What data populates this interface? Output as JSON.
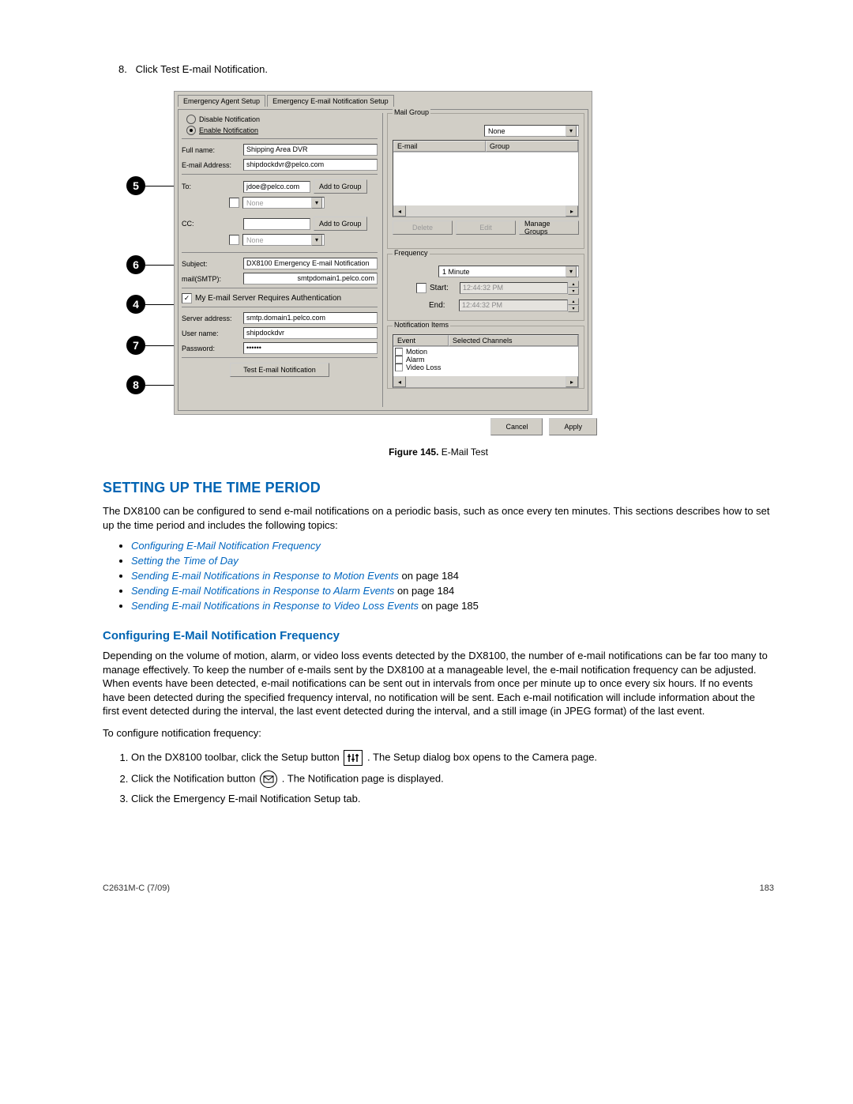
{
  "step8": {
    "num": "8.",
    "text": "Click Test E-mail Notification."
  },
  "callouts": {
    "c5": "5",
    "c6": "6",
    "c4": "4",
    "c7": "7",
    "c8": "8"
  },
  "shot": {
    "tabs": {
      "agent": "Emergency Agent Setup",
      "email": "Emergency E-mail Notification Setup"
    },
    "radios": {
      "disable": "Disable Notification",
      "enable": "Enable Notification"
    },
    "left": {
      "full_name_label": "Full name:",
      "full_name_value": "Shipping Area DVR",
      "email_label": "E-mail Address:",
      "email_value": "shipdockdvr@pelco.com",
      "to_label": "To:",
      "to_value": "jdoe@pelco.com",
      "btn_add": "Add to Group",
      "none": "None",
      "cc_label": "CC:",
      "subject_label": "Subject:",
      "subject_value": "DX8100 Emergency E-mail Notification",
      "smtp_label": "mail(SMTP):",
      "smtp_value": "smtpdomain1.pelco.com",
      "auth_label": "My E-mail Server Requires Authentication",
      "server_label": "Server address:",
      "server_value": "smtp.domain1.pelco.com",
      "user_label": "User name:",
      "user_value": "shipdockdvr",
      "pwd_label": "Password:",
      "pwd_value": "••••••",
      "test_btn": "Test E-mail Notification"
    },
    "right": {
      "mailgroup": {
        "legend": "Mail Group",
        "none": "None",
        "col_email": "E-mail",
        "col_group": "Group",
        "btn_del": "Delete",
        "btn_edit": "Edit",
        "btn_manage": "Manage Groups"
      },
      "freq": {
        "legend": "Frequency",
        "value": "1 Minute",
        "start_label": "Start:",
        "start_value": "12:44:32 PM",
        "end_label": "End:",
        "end_value": "12:44:32 PM"
      },
      "notif": {
        "legend": "Notification Items",
        "col_event": "Event",
        "col_chan": "Selected Channels",
        "motion": "Motion",
        "alarm": "Alarm",
        "video": "Video Loss"
      }
    },
    "footer": {
      "cancel": "Cancel",
      "apply": "Apply"
    }
  },
  "figcap": {
    "bold": "Figure 145.",
    "rest": "  E-Mail Test"
  },
  "h2": "SETTING UP THE TIME PERIOD",
  "p1": "The DX8100 can be configured to send e-mail notifications on a periodic basis, such as once every ten minutes. This sections describes how to set up the time period and includes the following topics:",
  "links": {
    "l1": "Configuring E-Mail Notification Frequency",
    "l2": "Setting the Time of Day",
    "l3_link": "Sending E-mail Notifications in Response to Motion Events",
    "l3_rest": " on page 184",
    "l4_link": "Sending E-mail Notifications in Response to Alarm Events",
    "l4_rest": " on page 184",
    "l5_link": "Sending E-mail Notifications in Response to Video Loss Events",
    "l5_rest": " on page 185"
  },
  "h3": "Configuring E-Mail Notification Frequency",
  "p2": "Depending on the volume of motion, alarm, or video loss events detected by the DX8100, the number of e-mail notifications can be far too many to manage effectively. To keep the number of e-mails sent by the DX8100 at a manageable level, the e-mail notification frequency can be adjusted. When events have been detected, e-mail notifications can be sent out in intervals from once per minute up to once every six hours. If no events have been detected during the specified frequency interval, no notification will be sent. Each e-mail notification will include information about the first event detected during the interval, the last event detected during the interval, and a still image (in JPEG format) of the last event.",
  "p3": "To configure notification frequency:",
  "steps": {
    "s1a": "On the DX8100 toolbar, click the Setup button ",
    "s1b": ". The Setup dialog box opens to the Camera page.",
    "s2a": "Click the Notification button ",
    "s2b": ". The Notification page is displayed.",
    "s3": "Click the Emergency E-mail Notification Setup tab."
  },
  "footer": {
    "left": "C2631M-C (7/09)",
    "right": "183"
  }
}
